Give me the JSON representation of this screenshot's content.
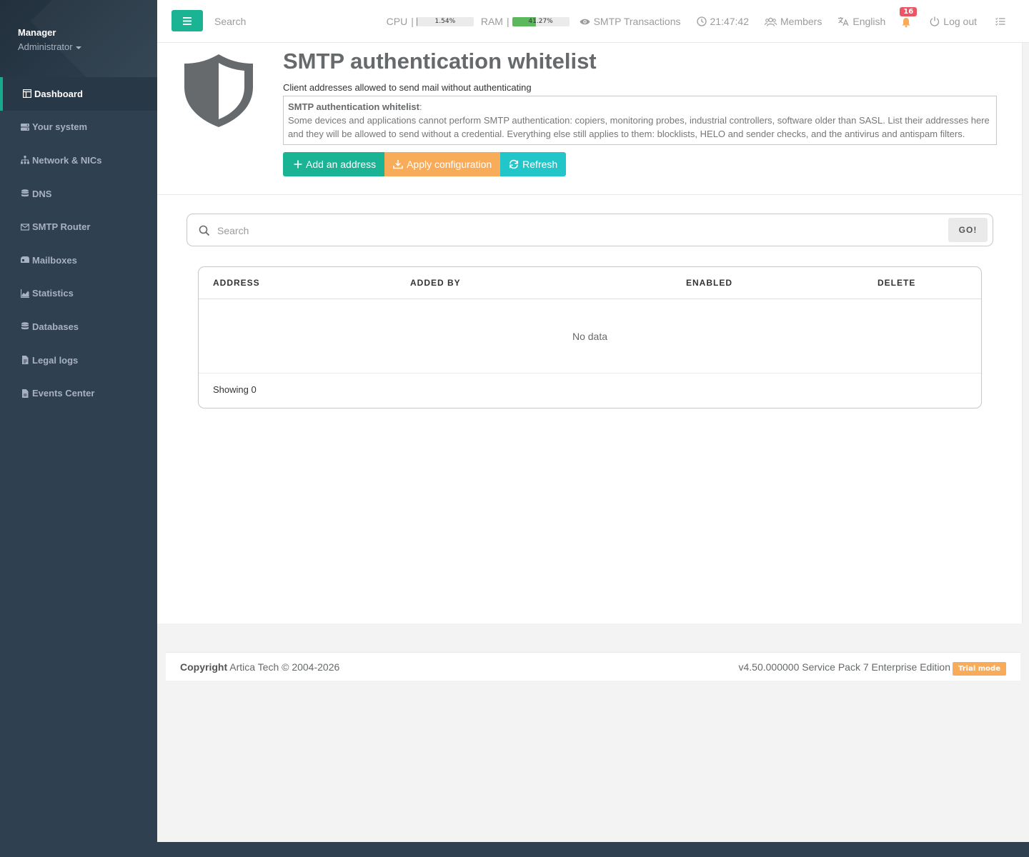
{
  "profile": {
    "name": "Manager",
    "role": "Administrator"
  },
  "sidebar": {
    "items": [
      {
        "label": "Dashboard",
        "icon": "dashboard-icon"
      },
      {
        "label": "Your system",
        "icon": "server-icon"
      },
      {
        "label": "Network & NICs",
        "icon": "network-icon"
      },
      {
        "label": "DNS",
        "icon": "database-icon"
      },
      {
        "label": "SMTP Router",
        "icon": "envelope-icon"
      },
      {
        "label": "Mailboxes",
        "icon": "mailbox-icon"
      },
      {
        "label": "Statistics",
        "icon": "chart-icon"
      },
      {
        "label": "Databases",
        "icon": "database-icon"
      },
      {
        "label": "Legal logs",
        "icon": "file-icon"
      },
      {
        "label": "Events Center",
        "icon": "file-alt-icon"
      }
    ]
  },
  "topbar": {
    "search_placeholder": "Search",
    "cpu_label": "CPU",
    "cpu_value": "1.54%",
    "cpu_fraction": 0.0154,
    "ram_label": "RAM",
    "ram_value": "41.27%",
    "ram_fraction": 0.4127,
    "smtp_transactions": "SMTP Transactions",
    "clock": "21:47:42",
    "members": "Members",
    "language": "English",
    "notifications_count": "16",
    "logout": "Log out"
  },
  "page": {
    "title": "SMTP authentication whitelist",
    "subtitle": "Client addresses allowed to send mail without authenticating",
    "explain_title": "SMTP authentication whitelist",
    "explain_text": "Some devices and applications cannot perform SMTP authentication: copiers, monitoring probes, industrial controllers, software older than SASL. List their addresses here and they will be allowed to send without a credential. Everything else still applies to them: blocklists, HELO and sender checks, and the antivirus and antispam filters.",
    "buttons": {
      "add": "Add an address",
      "apply": "Apply configuration",
      "refresh": "Refresh"
    }
  },
  "search": {
    "placeholder": "Search",
    "go_label": "GO!"
  },
  "table": {
    "columns": [
      "ADDRESS",
      "ADDED BY",
      "ENABLED",
      "DELETE"
    ],
    "rows": [],
    "empty_text": "No data",
    "showing": "Showing 0"
  },
  "footer": {
    "copyright_label": "Copyright",
    "copyright_text": "Artica Tech © 2004-2026",
    "version": "v4.50.000000 Service Pack 7 Enterprise Edition",
    "trial": "Trial mode"
  },
  "colors": {
    "accent": "#1ab394",
    "warning": "#f8ac59",
    "info": "#23c6c8",
    "sidebar": "#2f4050",
    "badge": "#ed5565"
  }
}
